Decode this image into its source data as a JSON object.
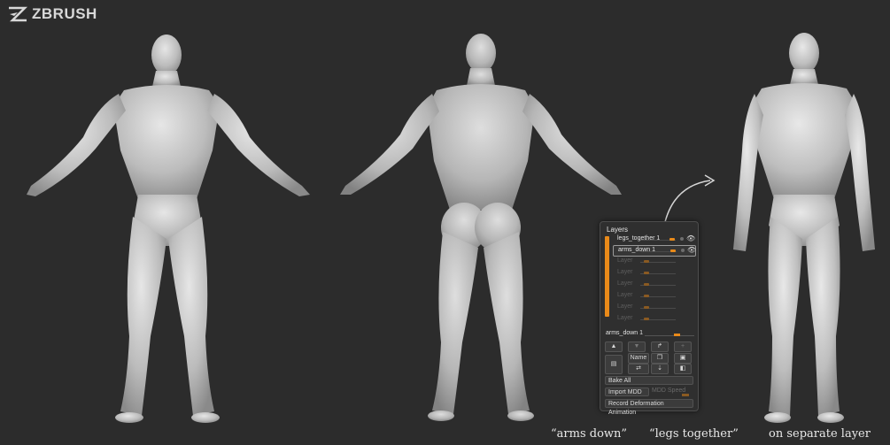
{
  "app": {
    "logo_text": "ZBRUSH"
  },
  "layers_panel": {
    "title": "Layers",
    "layers": [
      {
        "name": "legs_together 1",
        "active": true,
        "selected": false
      },
      {
        "name": "arms_down 1",
        "active": true,
        "selected": true
      },
      {
        "name": "Layer",
        "active": false,
        "selected": false
      },
      {
        "name": "Layer",
        "active": false,
        "selected": false
      },
      {
        "name": "Layer",
        "active": false,
        "selected": false
      },
      {
        "name": "Layer",
        "active": false,
        "selected": false
      },
      {
        "name": "Layer",
        "active": false,
        "selected": false
      },
      {
        "name": "Layer",
        "active": false,
        "selected": false
      }
    ],
    "current_layer_name": "arms_down 1",
    "name_button": "Name",
    "bake_all": "Bake All",
    "import_mdd": "Import MDD",
    "mdd_speed": "MDD Speed",
    "record_deformation": "Record Deformation Animation"
  },
  "captions": {
    "arms_down": "“arms down”",
    "legs_together": "“legs together”",
    "separate_layer": "on separate layer"
  },
  "colors": {
    "accent": "#e98a19",
    "background": "#2c2c2c",
    "figure": "#c8c8c8"
  }
}
